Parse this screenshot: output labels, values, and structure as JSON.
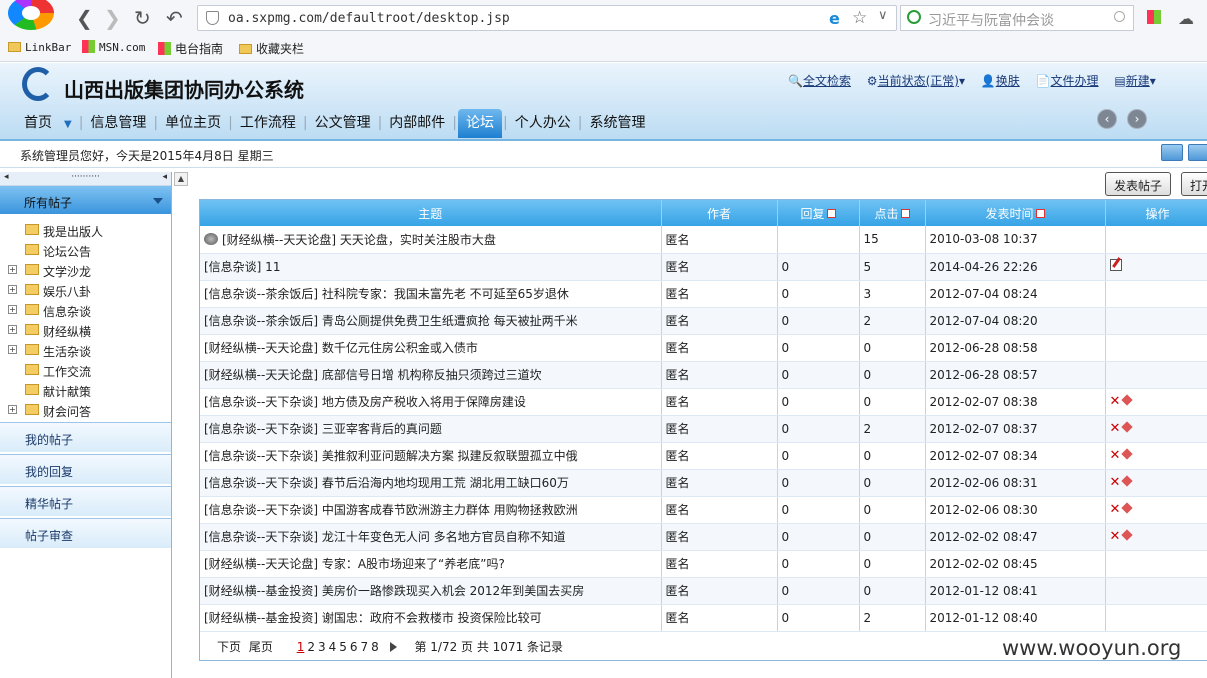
{
  "browser": {
    "url": "oa.sxpmg.com/defaultroot/desktop.jsp",
    "search_placeholder": "习近平与阮富仲会谈",
    "bookmarks": [
      "LinkBar",
      "MSN.com",
      "电台指南",
      "收藏夹栏"
    ]
  },
  "app": {
    "title": "山西出版集团协同办公系统",
    "toplinks": [
      "全文检索",
      "当前状态(正常)",
      "换肤",
      "文件办理",
      "新建"
    ],
    "menu": [
      "首页",
      "信息管理",
      "单位主页",
      "工作流程",
      "公文管理",
      "内部邮件",
      "论坛",
      "个人办公",
      "系统管理"
    ],
    "active_menu": "论坛",
    "welcome": "系统管理员您好，今天是2015年4月8日  星期三"
  },
  "sidebar": {
    "dots": "··········",
    "header": "所有帖子",
    "tree": [
      {
        "label": "我是出版人",
        "expandable": false
      },
      {
        "label": "论坛公告",
        "expandable": false
      },
      {
        "label": "文学沙龙",
        "expandable": true
      },
      {
        "label": "娱乐八卦",
        "expandable": true
      },
      {
        "label": "信息杂谈",
        "expandable": true
      },
      {
        "label": "财经纵横",
        "expandable": true
      },
      {
        "label": "生活杂谈",
        "expandable": true
      },
      {
        "label": "工作交流",
        "expandable": false
      },
      {
        "label": "献计献策",
        "expandable": false
      },
      {
        "label": "财会问答",
        "expandable": true
      }
    ],
    "sections": [
      "我的帖子",
      "我的回复",
      "精华帖子",
      "帖子审查"
    ]
  },
  "toolbar": {
    "post_button": "发表帖子",
    "open_button": "打开"
  },
  "table": {
    "headers": [
      "主题",
      "作者",
      "回复",
      "点击",
      "发表时间",
      "操作"
    ],
    "rows": [
      {
        "topic": "[财经纵横--天天论盘] 天天论盘，实时关注股市大盘",
        "author": "匿名",
        "replies": "",
        "clicks": "15",
        "time": "2010-03-08 10:37",
        "ops": "pinned"
      },
      {
        "topic": "[信息杂谈] 11",
        "author": "匿名",
        "replies": "0",
        "clicks": "5",
        "time": "2014-04-26 22:26",
        "ops": "edit"
      },
      {
        "topic": "[信息杂谈--茶余饭后] 社科院专家：我国未富先老 不可延至65岁退休",
        "author": "匿名",
        "replies": "0",
        "clicks": "3",
        "time": "2012-07-04 08:24",
        "ops": ""
      },
      {
        "topic": "[信息杂谈--茶余饭后] 青岛公厕提供免费卫生纸遭疯抢 每天被扯两千米",
        "author": "匿名",
        "replies": "0",
        "clicks": "2",
        "time": "2012-07-04 08:20",
        "ops": ""
      },
      {
        "topic": "[财经纵横--天天论盘] 数千亿元住房公积金或入债市",
        "author": "匿名",
        "replies": "0",
        "clicks": "0",
        "time": "2012-06-28 08:58",
        "ops": ""
      },
      {
        "topic": "[财经纵横--天天论盘] 底部信号日增 机构称反抽只须跨过三道坎",
        "author": "匿名",
        "replies": "0",
        "clicks": "0",
        "time": "2012-06-28 08:57",
        "ops": ""
      },
      {
        "topic": "[信息杂谈--天下杂谈] 地方债及房产税收入将用于保障房建设",
        "author": "匿名",
        "replies": "0",
        "clicks": "0",
        "time": "2012-02-07 08:38",
        "ops": "delmove"
      },
      {
        "topic": "[信息杂谈--天下杂谈] 三亚宰客背后的真问题",
        "author": "匿名",
        "replies": "0",
        "clicks": "2",
        "time": "2012-02-07 08:37",
        "ops": "delmove"
      },
      {
        "topic": "[信息杂谈--天下杂谈] 美推叙利亚问题解决方案 拟建反叙联盟孤立中俄",
        "author": "匿名",
        "replies": "0",
        "clicks": "0",
        "time": "2012-02-07 08:34",
        "ops": "delmove"
      },
      {
        "topic": "[信息杂谈--天下杂谈] 春节后沿海内地均现用工荒 湖北用工缺口60万",
        "author": "匿名",
        "replies": "0",
        "clicks": "0",
        "time": "2012-02-06 08:31",
        "ops": "delmove"
      },
      {
        "topic": "[信息杂谈--天下杂谈] 中国游客成春节欧洲游主力群体 用购物拯救欧洲",
        "author": "匿名",
        "replies": "0",
        "clicks": "0",
        "time": "2012-02-06 08:30",
        "ops": "delmove"
      },
      {
        "topic": "[信息杂谈--天下杂谈] 龙江十年变色无人问 多名地方官员自称不知道",
        "author": "匿名",
        "replies": "0",
        "clicks": "0",
        "time": "2012-02-02 08:47",
        "ops": "delmove"
      },
      {
        "topic": "[财经纵横--天天论盘] 专家：A股市场迎来了“养老底”吗?",
        "author": "匿名",
        "replies": "0",
        "clicks": "0",
        "time": "2012-02-02 08:45",
        "ops": ""
      },
      {
        "topic": "[财经纵横--基金投资] 美房价一路惨跌现买入机会 2012年到美国去买房",
        "author": "匿名",
        "replies": "0",
        "clicks": "0",
        "time": "2012-01-12 08:41",
        "ops": ""
      },
      {
        "topic": "[财经纵横--基金投资] 谢国忠：政府不会救楼市 投资保险比较可",
        "author": "匿名",
        "replies": "0",
        "clicks": "2",
        "time": "2012-01-12 08:40",
        "ops": ""
      }
    ]
  },
  "pager": {
    "prev": "下页",
    "last": "尾页",
    "pages": [
      "1",
      "2",
      "3",
      "4",
      "5",
      "6",
      "7",
      "8"
    ],
    "current": "1",
    "info": "第 1/72 页 共 1071 条记录"
  },
  "watermark": "www.wooyun.org"
}
